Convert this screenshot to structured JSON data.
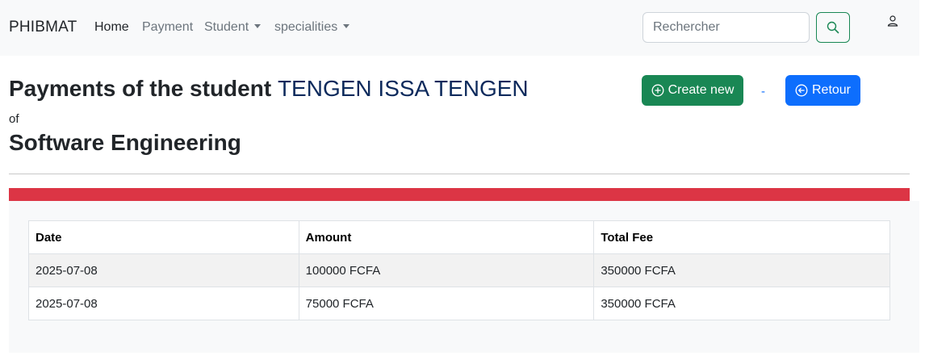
{
  "navbar": {
    "brand": "PHIBMAT",
    "links": [
      {
        "label": "Home"
      },
      {
        "label": "Payment"
      },
      {
        "label": "Student"
      },
      {
        "label": "specialities"
      }
    ],
    "search": {
      "placeholder": "Rechercher",
      "value": ""
    },
    "icons": {
      "search": "search-icon",
      "user": "user-icon"
    }
  },
  "header": {
    "title_prefix": "Payments of the student",
    "student_name": "TENGEN ISSA TENGEN",
    "of_label": "of",
    "speciality": "Software Engineering",
    "create_label": "Create new",
    "separator": "-",
    "back_label": "Retour"
  },
  "table": {
    "columns": [
      "Date",
      "Amount",
      "Total Fee"
    ],
    "rows": [
      [
        "2025-07-08",
        "100000 FCFA",
        "350000 FCFA"
      ],
      [
        "2025-07-08",
        "75000 FCFA",
        "350000 FCFA"
      ]
    ]
  },
  "colors": {
    "success": "#198754",
    "primary": "#0d6efd",
    "danger": "#dc3545",
    "student_name": "#0d2a5c"
  }
}
